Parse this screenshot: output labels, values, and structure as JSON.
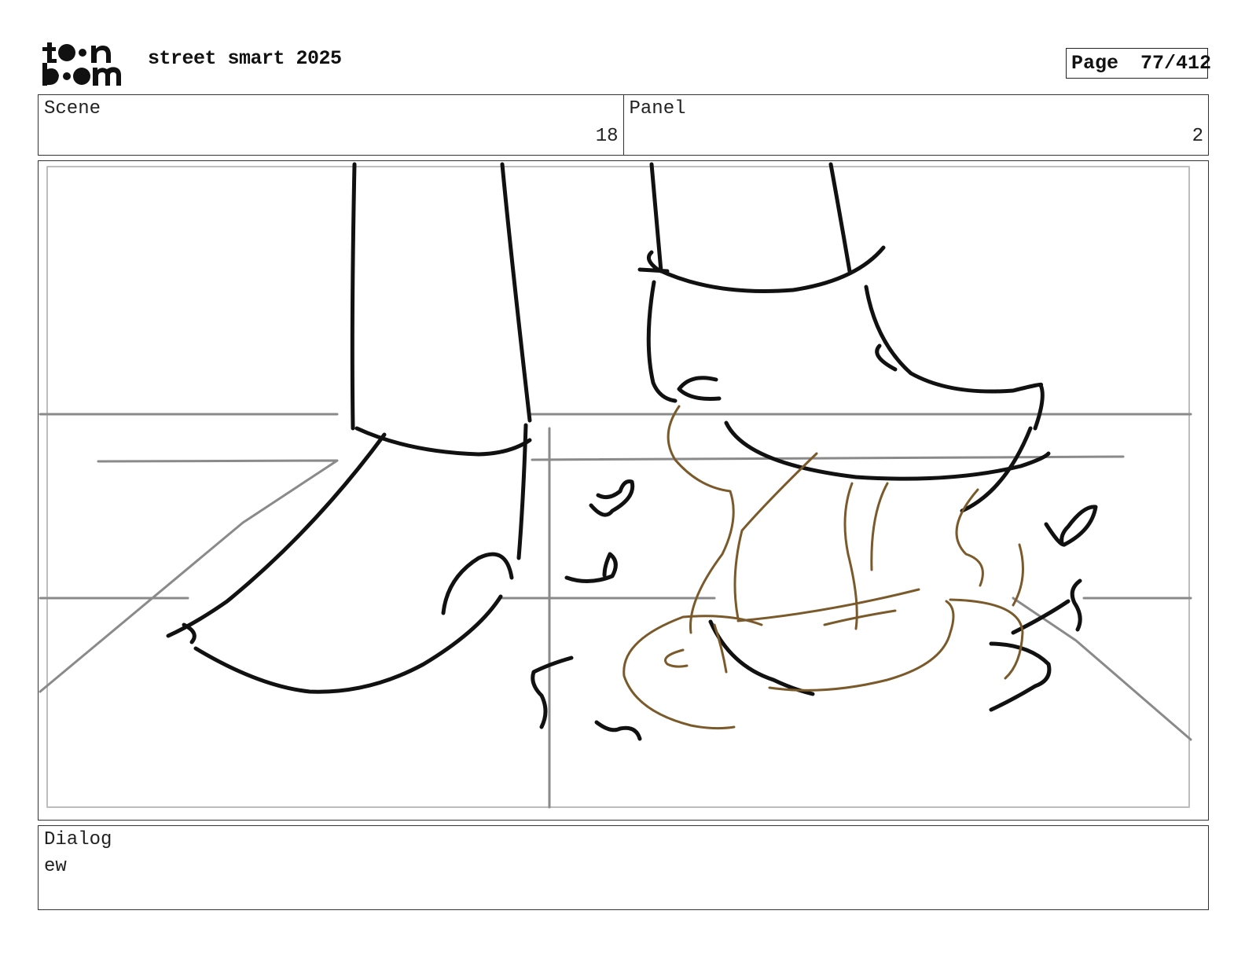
{
  "header": {
    "logo_text": "toon boom",
    "project_title": "street smart 2025",
    "page_label": "Page",
    "page_number": "77/412"
  },
  "info": {
    "scene_label": "Scene",
    "scene_value": "18",
    "panel_label": "Panel",
    "panel_value": "2"
  },
  "dialog": {
    "label": "Dialog",
    "text": "ew"
  },
  "colors": {
    "sketch_line": "#111111",
    "perspective_line": "#8a8a8a",
    "stink_lines": "#7a5a2a"
  }
}
